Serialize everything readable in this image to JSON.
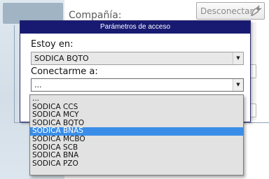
{
  "background": {
    "company_label": "Compañía:",
    "disconnect_label": "Desconectar",
    "plug_icon": "plug-icon"
  },
  "dialog": {
    "title": "Parámetros de acceso",
    "estoy_en": {
      "label": "Estoy en:",
      "value": "SODICA BQTO"
    },
    "conectarme_a": {
      "label": "Conectarme a:",
      "value": "...",
      "options": [
        "...",
        "SODICA CCS",
        "SODICA MCY",
        "SODICA BQTO",
        "SODICA BNAS",
        "SODICA MCBO",
        "SODICA SCB",
        "SODICA BNA",
        "SODICA PZO"
      ],
      "highlighted": "SODICA BNAS"
    }
  },
  "colors": {
    "title_bar": "#181a72",
    "highlight": "#3a8ee8"
  }
}
